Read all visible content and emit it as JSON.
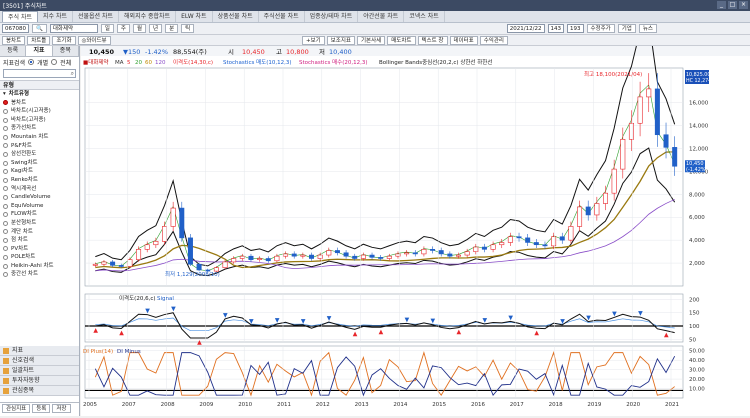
{
  "window": {
    "title": "[3501] 주식차트"
  },
  "menu_tabs": [
    "주식 차트",
    "지수 차트",
    "선물옵션 차트",
    "해외지수 종합차트",
    "ELW 차트",
    "상품선물 차트",
    "주식선물 차트",
    "업종상/테마 차트",
    "야간선물 차트",
    "코넥스 차트"
  ],
  "toolbar": {
    "code": "067080",
    "stock_name": "대화제약",
    "period_day": "일",
    "period_week": "주",
    "period_month": "월",
    "period_year": "년",
    "period_min": "분",
    "period_tick": "틱",
    "date": "2021/12/22",
    "count": "143",
    "count2": "193",
    "adjust": "수정주가",
    "news": "기업",
    "news2": "뉴스"
  },
  "toolbar2": {
    "btn1": "봉차트",
    "btn2": "차트틀",
    "btn3": "조기화",
    "btn4": "◎와이드뷰",
    "btn5": "+보기",
    "btn6": "보조지표",
    "btn7": "기본사세",
    "btn8": "매도차트",
    "btn9": "텍스트 창",
    "btn10": "데이터표",
    "btn11": "수익관리"
  },
  "left_panel": {
    "tabs": [
      "등록",
      "지표",
      "종목"
    ],
    "search_label": "지표검색",
    "radio_individual": "개별",
    "radio_all": "전체",
    "section_type": "유형",
    "tree": [
      {
        "label": "차트유형",
        "group": true
      },
      {
        "label": "봉차트",
        "selected": true
      },
      {
        "label": "바차트(시고저종)"
      },
      {
        "label": "바차트(고저종)"
      },
      {
        "label": "종가선차트"
      },
      {
        "label": "Mountain 차트"
      },
      {
        "label": "P&F차트"
      },
      {
        "label": "삼선전환도"
      },
      {
        "label": "Swing차트"
      },
      {
        "label": "Kagi차트"
      },
      {
        "label": "Renko차트"
      },
      {
        "label": "역시계곡선"
      },
      {
        "label": "CandleVolume"
      },
      {
        "label": "EquiVolume"
      },
      {
        "label": "FLOW차트"
      },
      {
        "label": "분산형차트"
      },
      {
        "label": "계단 차트"
      },
      {
        "label": "점 차트"
      },
      {
        "label": "PV차트"
      },
      {
        "label": "POLE차트"
      },
      {
        "label": "Heikin-Ashi 차트"
      },
      {
        "label": "중간선 차트"
      }
    ],
    "categories": [
      "지표",
      "신호검색",
      "일괄차트",
      "투자자동향",
      "관심종목"
    ],
    "footer": [
      "관심지표",
      "등록",
      "저장"
    ]
  },
  "chart_header": {
    "price": "10,450",
    "change": "▼150",
    "change_pct": "-1.42%",
    "volume": "88,554(주)",
    "open_label": "시",
    "open": "10,450",
    "high_label": "고",
    "high": "10,800",
    "low_label": "저",
    "low": "10,400"
  },
  "legend": {
    "price": "■대화제약",
    "ma": "MA",
    "ma_periods": [
      "5",
      "20",
      "60",
      "120"
    ],
    "ind1": "이격도(14,30,c)",
    "ind2": "Stochastics 매도(10,12,3)",
    "ind3": "Stochastics 매수(20,12,3)",
    "ind4": "Bollinger Bands중심선(20,2,c) 상한선 하한선"
  },
  "annotations": {
    "high": "최고 18,100(2021/04)",
    "low": "최저 1,129(2008/10)"
  },
  "right_badges": {
    "top1": "10,825.00",
    "top2": "HC 12,274",
    "price": "10,450",
    "pct": "(-1.42%)"
  },
  "panels": {
    "mid_title": "이격도(20,6,c)",
    "mid_signal": "Signal",
    "bottom_title1": "DI Plus(14)",
    "bottom_title2": "DI Minus"
  },
  "colors": {
    "up": "#e8262b",
    "down": "#2060c8",
    "bg": "#ffffff",
    "grid": "#e2e5ea"
  },
  "chart_data": {
    "type": "candlestick",
    "x_labels": [
      "2005",
      "2007",
      "2008",
      "2009",
      "2010",
      "2011",
      "2012",
      "2013",
      "2014",
      "2015",
      "2016",
      "2017",
      "2018",
      "2019",
      "2020",
      "2021"
    ],
    "y_ticks_main": [
      2000,
      4000,
      6000,
      8000,
      10000,
      12000,
      14000,
      16000
    ],
    "y_ticks_mid": [
      50,
      100,
      150,
      200
    ],
    "y_ticks_bottom": [
      10,
      20,
      30,
      40,
      50
    ],
    "close": [
      1900,
      2100,
      1800,
      1700,
      2300,
      3200,
      3600,
      3900,
      5200,
      6800,
      4200,
      1900,
      1400,
      1300,
      1600,
      2100,
      2400,
      2600,
      2300,
      2400,
      2200,
      2600,
      2800,
      2600,
      2700,
      2400,
      2700,
      3100,
      2900,
      2600,
      2400,
      2700,
      2500,
      2400,
      2600,
      2800,
      2900,
      2800,
      3200,
      3100,
      2800,
      2600,
      2700,
      3000,
      3400,
      3200,
      3600,
      3800,
      4300,
      4200,
      3800,
      3600,
      3500,
      4300,
      4000,
      5200,
      6900,
      6200,
      7200,
      8100,
      10200,
      12800,
      14200,
      16500,
      17200,
      13200,
      12100,
      10450
    ],
    "ylim": [
      0,
      18500
    ]
  }
}
